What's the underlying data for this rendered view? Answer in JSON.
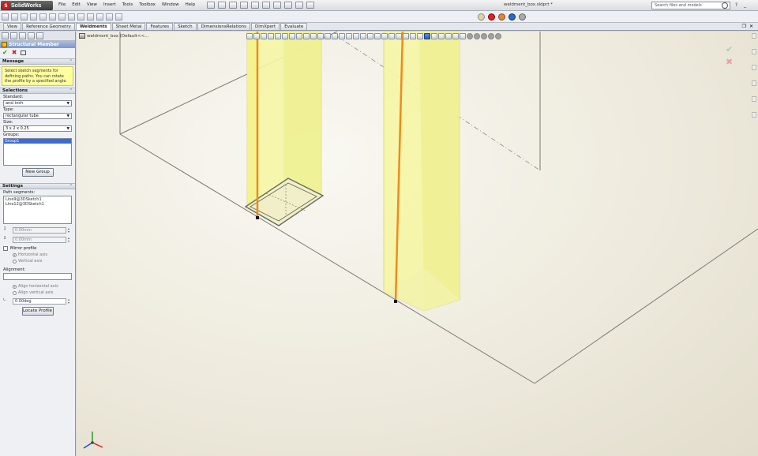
{
  "app": {
    "name": "SolidWorks",
    "document_title": "weldment_box.sldprt *",
    "menus": [
      "File",
      "Edit",
      "View",
      "Insert",
      "Tools",
      "Toolbox",
      "Window",
      "Help"
    ],
    "search_placeholder": "Search files and models"
  },
  "tabs": [
    {
      "label": "View",
      "active": false
    },
    {
      "label": "Reference Geometry",
      "active": false
    },
    {
      "label": "Weldments",
      "active": true
    },
    {
      "label": "Sheet Metal",
      "active": false
    },
    {
      "label": "Features",
      "active": false
    },
    {
      "label": "Sketch",
      "active": false
    },
    {
      "label": "DimensionsRelations",
      "active": false
    },
    {
      "label": "DimXpert",
      "active": false
    },
    {
      "label": "Evaluate",
      "active": false
    }
  ],
  "panel": {
    "title": "Structural Member",
    "message_header": "Message",
    "message_text": "Select sketch segments for defining paths. You can rotate the profile by a specified angle.",
    "selections_header": "Selections",
    "standard_label": "Standard:",
    "standard_value": "ansi inch",
    "type_label": "Type:",
    "type_value": "rectangular tube",
    "size_label": "Size:",
    "size_value": "3 x 2 x 0.25",
    "groups_label": "Groups:",
    "groups": [
      "Group1"
    ],
    "new_group_label": "New Group",
    "settings_header": "Settings",
    "path_segments_label": "Path segments:",
    "path_segments": [
      "Line9@3DSketch1",
      "Line12@3DSketch1"
    ],
    "field1_value": "0.00mm",
    "field2_value": "0.00mm",
    "mirror_label": "Mirror profile",
    "horizontal_axis_label": "Horizontal axis",
    "vertical_axis_label": "Vertical axis",
    "alignment_label": "Alignment:",
    "align_horizontal_label": "Align horizontal axis",
    "align_vertical_label": "Align vertical axis",
    "angle_value": "0.00deg",
    "locate_profile_label": "Locate Profile"
  },
  "viewport": {
    "tree_label": "weldment_box (Default<<..."
  },
  "colors": {
    "member_fill": "#f6f7a6",
    "path_line": "#f08a1c",
    "accent_blue": "#3c6bd6",
    "panel_header": "#8aa2cf"
  }
}
